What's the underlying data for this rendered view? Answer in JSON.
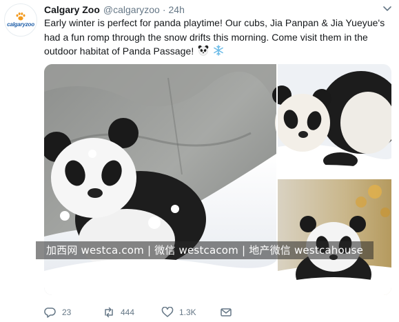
{
  "tweet": {
    "avatar_text": "calgaryzoo",
    "name": "Calgary Zoo",
    "handle": "@calgaryzoo",
    "separator": "·",
    "time": "24h",
    "text": "Early winter is perfect for panda playtime! Our cubs, Jia Panpan & Jia Yueyue's had a fun romp through the snow drifts this morning. Come visit them in the outdoor habitat of Panda Passage!",
    "emojis": [
      "panda-face",
      "snowflake"
    ]
  },
  "watermark": {
    "text": "加西网 westca.com | 微信 westcacom | 地产微信 westcahouse"
  },
  "actions": {
    "reply_count": "23",
    "retweet_count": "444",
    "like_count": "1.3K"
  },
  "icons": {
    "reply": "reply-icon",
    "retweet": "retweet-icon",
    "like": "heart-icon",
    "share": "envelope-icon",
    "menu": "chevron-down-icon"
  },
  "colors": {
    "text": "#14171a",
    "secondary": "#657786",
    "brand": "#1e5ea8",
    "brand_orange": "#f29a1f"
  }
}
